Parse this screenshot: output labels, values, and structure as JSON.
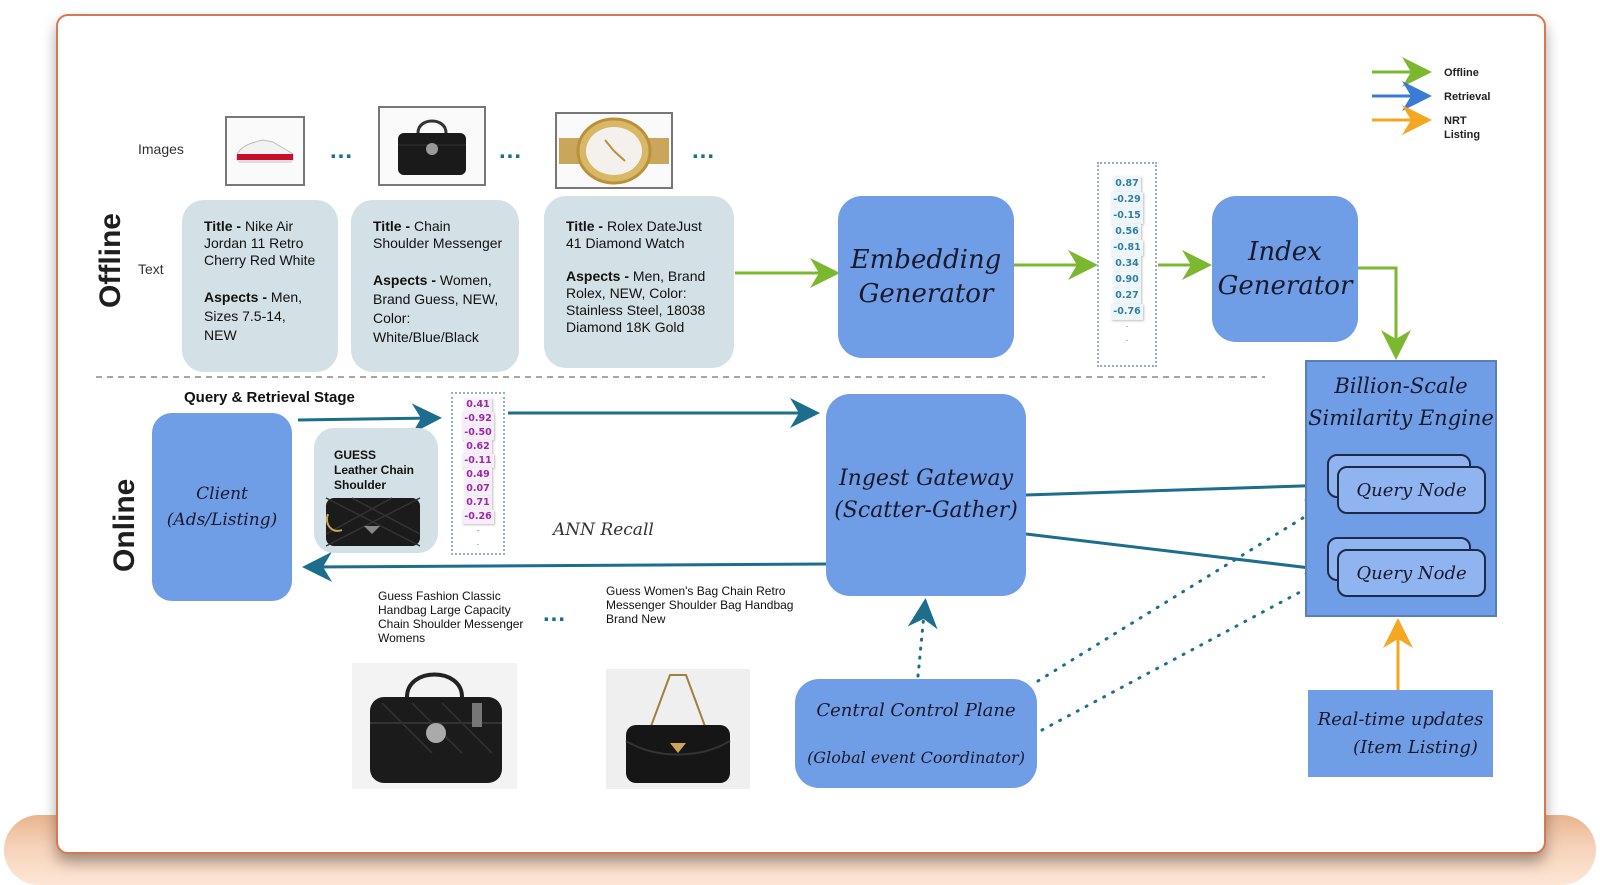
{
  "legend": [
    {
      "label": "Offline",
      "color": "#7cb82f"
    },
    {
      "label": "Retrieval",
      "color": "#3a7bd5"
    },
    {
      "label": "NRT\nListing",
      "color": "#f5a623"
    }
  ],
  "sections": {
    "offline": "Offline",
    "online": "Online"
  },
  "row_labels": {
    "images": "Images",
    "text": "Text"
  },
  "ellipsis": "...",
  "offline_items": [
    {
      "image": "red-white-sneaker",
      "title_label": "Title -",
      "title": "Nike Air Jordan 11 Retro Cherry Red White",
      "aspects_label": "Aspects -",
      "aspects": "Men, Sizes 7.5-14, NEW"
    },
    {
      "image": "black-handbag",
      "title_label": "Title -",
      "title": "Chain Shoulder Messenger",
      "aspects_label": "Aspects -",
      "aspects": "Women, Brand  Guess, NEW, Color: White/Blue/Black"
    },
    {
      "image": "gold-watch",
      "title_label": "Title -",
      "title": "Rolex DateJust 41 Diamond Watch",
      "aspects_label": "Aspects -",
      "aspects": "Men, Brand Rolex, NEW, Color: Stainless Steel, 18038 Diamond 18K Gold"
    }
  ],
  "embedding_generator": {
    "line1": "Embedding",
    "line2": "Generator"
  },
  "offline_vector": [
    "0.87",
    "-0.29",
    "-0.15",
    "0.56",
    "-0.81",
    "0.34",
    "0.90",
    "0.27",
    "-0.76"
  ],
  "index_generator": {
    "line1": "Index",
    "line2": "Generator"
  },
  "similarity_engine": {
    "line1": "Billion-Scale",
    "line2": "Similarity Engine",
    "nodes": [
      "Query Node",
      "Query Node"
    ]
  },
  "query_stage": {
    "title": "Query &  Retrieval Stage"
  },
  "client": {
    "line1": "Client",
    "line2": "(Ads/Listing)"
  },
  "query_item": {
    "line1": "GUESS",
    "line2": "Leather Chain",
    "line3": "Shoulder"
  },
  "online_vector": [
    "0.41",
    "-0.92",
    "-0.50",
    "0.62",
    "-0.11",
    "0.49",
    "0.07",
    "0.71",
    "-0.26"
  ],
  "ann_recall": "ANN Recall",
  "ingest_gateway": {
    "line1": "Ingest Gateway",
    "line2": "(Scatter-Gather)"
  },
  "results": [
    {
      "text": "Guess Fashion Classic Handbag Large Capacity Chain Shoulder Messenger Womens"
    },
    {
      "text": "Guess Women's Bag Chain Retro Messenger Shoulder Bag Handbag Brand New"
    }
  ],
  "control_plane": {
    "line1": "Central Control Plane",
    "line2": "(Global event Coordinator)"
  },
  "realtime": {
    "line1": "Real-time updates",
    "line2": "(Item Listing)"
  },
  "colors": {
    "offline_arrow": "#7cb82f",
    "retrieval_arrow": "#1c6e8c",
    "nrt_arrow": "#f5a623",
    "box_blue": "#6f9de6",
    "card_gray": "#d3e1e6",
    "frame_border": "#d9774f"
  }
}
